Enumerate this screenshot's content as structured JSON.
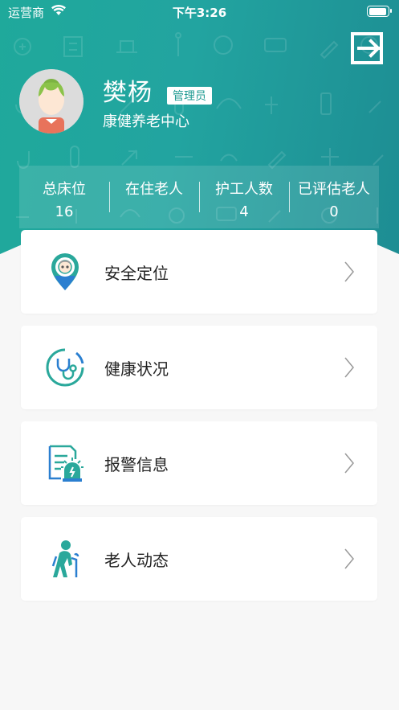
{
  "status_bar": {
    "carrier": "运营商",
    "time": "下午3:26",
    "battery_level": 0.95
  },
  "header": {
    "user_name": "樊杨",
    "role": "管理员",
    "organization": "康健养老中心",
    "logout_icon": "logout-icon",
    "avatar_icon": "elder-avatar-icon"
  },
  "stats": [
    {
      "label": "总床位",
      "value": "16"
    },
    {
      "label": "在住老人",
      "value": ""
    },
    {
      "label": "护工人数",
      "value": "4"
    },
    {
      "label": "已评估老人",
      "value": "0"
    }
  ],
  "menu": [
    {
      "label": "安全定位",
      "icon": "location-pin-icon"
    },
    {
      "label": "健康状况",
      "icon": "stethoscope-icon"
    },
    {
      "label": "报警信息",
      "icon": "alarm-report-icon"
    },
    {
      "label": "老人动态",
      "icon": "elder-walking-icon"
    }
  ],
  "colors": {
    "primary": "#1fa99b",
    "primary_dark": "#1d8d93",
    "accent_blue": "#2a7fd0",
    "background": "#f7f7f7"
  }
}
